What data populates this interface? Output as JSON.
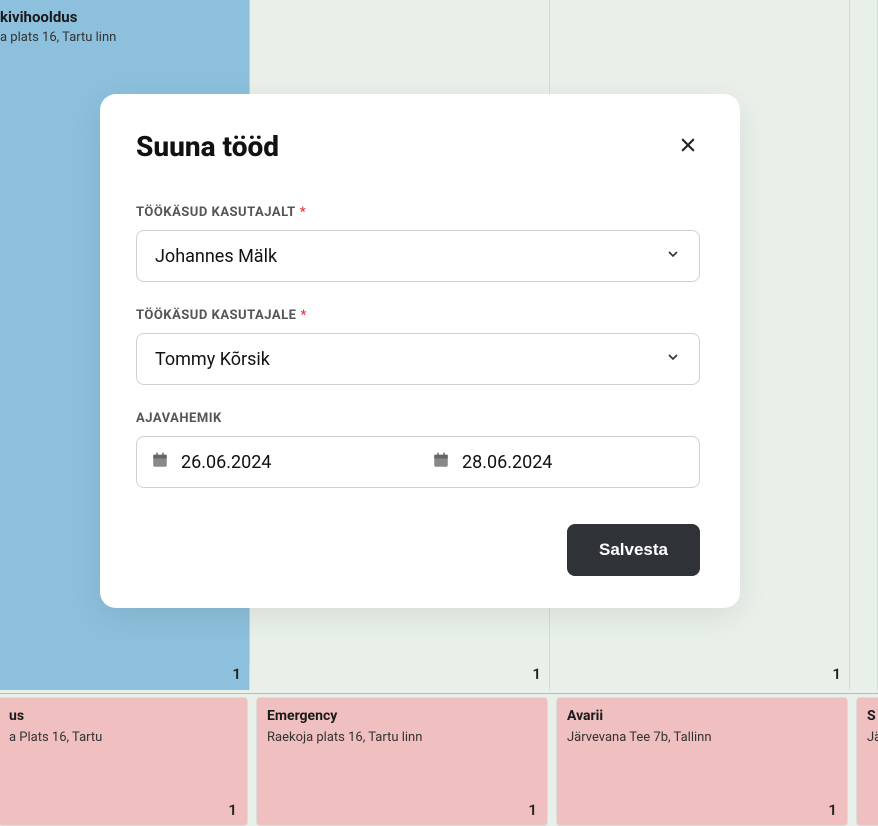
{
  "bg": {
    "top_card": {
      "title": "kivihooldus",
      "addr": "a plats 16, Tartu linn"
    },
    "day_numbers": [
      "1",
      "1",
      "1"
    ],
    "tasks": [
      {
        "title": "us",
        "addr": "a Plats 16, Tartu",
        "badge": "1"
      },
      {
        "title": "Emergency",
        "addr": "Raekoja plats 16, Tartu linn",
        "badge": "1"
      },
      {
        "title": "Avarii",
        "addr": "Järvevana Tee 7b, Tallinn",
        "badge": "1"
      },
      {
        "title": "S",
        "addr": "Jä",
        "badge": ""
      }
    ]
  },
  "modal": {
    "title": "Suuna tööd",
    "from_label": "TÖÖKÄSUD KASUTAJALT",
    "from_value": "Johannes Mälk",
    "to_label": "TÖÖKÄSUD KASUTAJALE",
    "to_value": "Tommy Kõrsik",
    "range_label": "AJAVAHEMIK",
    "date_from": "26.06.2024",
    "date_to": "28.06.2024",
    "save_label": "Salvesta"
  }
}
